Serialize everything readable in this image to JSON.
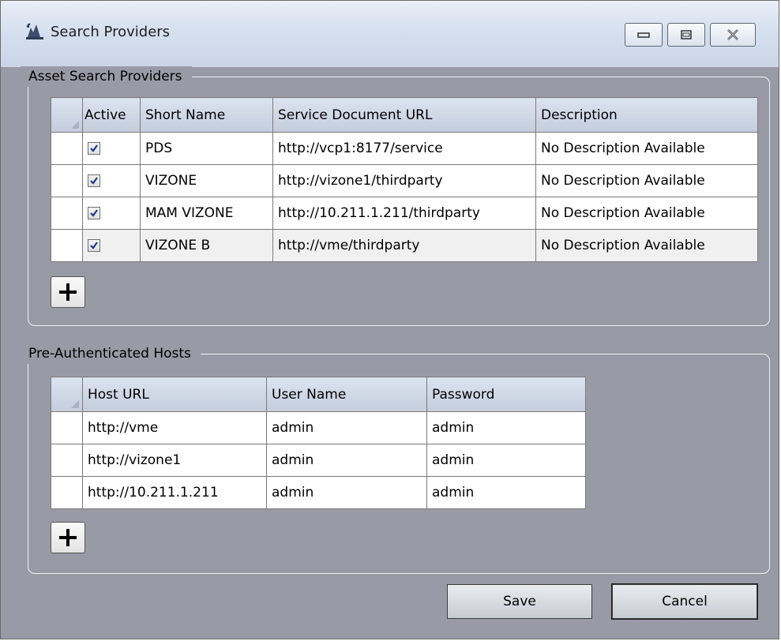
{
  "window": {
    "title": "Search Providers"
  },
  "asset_group": {
    "legend": "Asset Search Providers",
    "columns": [
      "Active",
      "Short Name",
      "Service Document URL",
      "Description"
    ],
    "rows": [
      {
        "active": true,
        "short_name": "PDS",
        "url": "http://vcp1:8177/service",
        "description": "No Description Available"
      },
      {
        "active": true,
        "short_name": "VIZONE",
        "url": "http://vizone1/thirdparty",
        "description": "No Description Available"
      },
      {
        "active": true,
        "short_name": "MAM VIZONE",
        "url": "http://10.211.1.211/thirdparty",
        "description": "No Description Available"
      },
      {
        "active": true,
        "short_name": "VIZONE B",
        "url": "http://vme/thirdparty",
        "description": "No Description Available"
      }
    ]
  },
  "hosts_group": {
    "legend": "Pre-Authenticated Hosts",
    "columns": [
      "Host URL",
      "User Name",
      "Password"
    ],
    "rows": [
      {
        "host": "http://vme",
        "user": "admin",
        "password": "admin"
      },
      {
        "host": "http://vizone1",
        "user": "admin",
        "password": "admin"
      },
      {
        "host": "http://10.211.1.211",
        "user": "admin",
        "password": "admin"
      }
    ]
  },
  "buttons": {
    "save": "Save",
    "cancel": "Cancel"
  }
}
